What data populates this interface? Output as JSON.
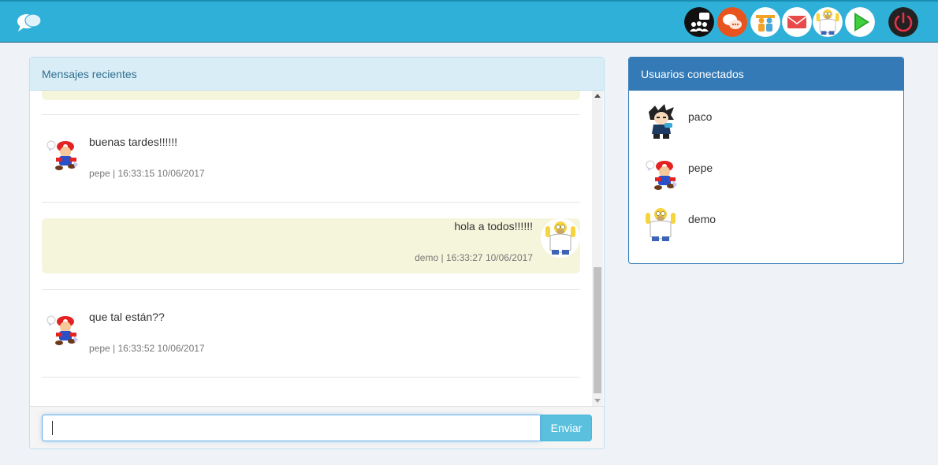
{
  "colors": {
    "navbar": "#2fb0d8",
    "panel_info_heading": "#d9edf7",
    "panel_primary": "#337ab7",
    "own_message_bg": "#f5f5dc",
    "send_button": "#5bc0de"
  },
  "navbar": {
    "brand_icon": "chat-bubbles-icon",
    "icons": [
      {
        "name": "group-chat-icon"
      },
      {
        "name": "conversations-icon"
      },
      {
        "name": "contacts-icon"
      },
      {
        "name": "mail-icon"
      },
      {
        "name": "user-avatar-icon"
      },
      {
        "name": "play-icon"
      },
      {
        "name": "power-icon"
      }
    ]
  },
  "messages_panel": {
    "title": "Mensajes recientes",
    "messages": [
      {
        "author": "pepe",
        "own": false,
        "text": "buenas tardes!!!!!!",
        "meta": "pepe | 16:33:15 10/06/2017"
      },
      {
        "author": "demo",
        "own": true,
        "text": "hola a todos!!!!!!",
        "meta": "demo | 16:33:27 10/06/2017"
      },
      {
        "author": "pepe",
        "own": false,
        "text": "que tal están??",
        "meta": "pepe | 16:33:52 10/06/2017"
      }
    ],
    "input_value": "",
    "send_label": "Enviar"
  },
  "users_panel": {
    "title": "Usuarios conectados",
    "users": [
      {
        "name": "paco",
        "avatar": "anime-boy-avatar"
      },
      {
        "name": "pepe",
        "avatar": "mario-avatar"
      },
      {
        "name": "demo",
        "avatar": "homer-avatar"
      }
    ]
  }
}
